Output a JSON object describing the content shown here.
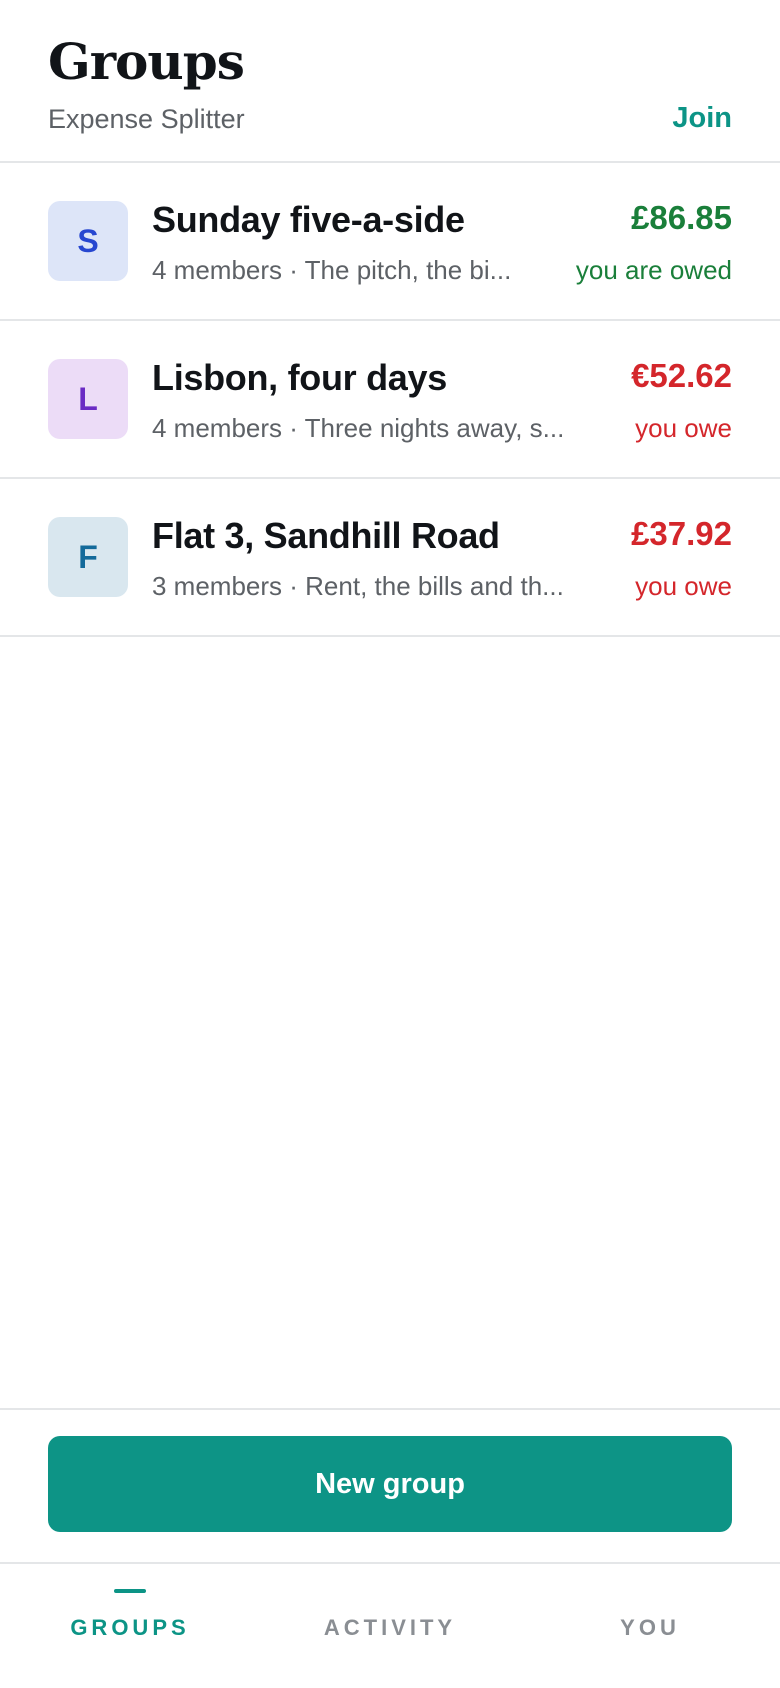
{
  "header": {
    "title": "Groups",
    "subtitle": "Expense Splitter",
    "join_label": "Join"
  },
  "groups": [
    {
      "initial": "S",
      "name": "Sunday five-a-side",
      "subtitle": "4 members · The pitch, the bi...",
      "amount": "£86.85",
      "status": "you are owed",
      "status_type": "owed",
      "avatar_bg": "#dde5f8",
      "avatar_fg": "#2747d0",
      "amount_color": "#1a7f3a"
    },
    {
      "initial": "L",
      "name": "Lisbon, four days",
      "subtitle": "4 members · Three nights away, s...",
      "amount": "€52.62",
      "status": "you owe",
      "status_type": "owe",
      "avatar_bg": "#ecdcf7",
      "avatar_fg": "#6a2bc4",
      "amount_color": "#d4262b"
    },
    {
      "initial": "F",
      "name": "Flat 3, Sandhill Road",
      "subtitle": "3 members · Rent, the bills and th...",
      "amount": "£37.92",
      "status": "you owe",
      "status_type": "owe",
      "avatar_bg": "#d9e7ef",
      "avatar_fg": "#136a9a",
      "amount_color": "#d4262b"
    }
  ],
  "actions": {
    "new_group_label": "New group"
  },
  "tabs": [
    {
      "label": "GROUPS",
      "active": true
    },
    {
      "label": "ACTIVITY",
      "active": false
    },
    {
      "label": "YOU",
      "active": false
    }
  ],
  "colors": {
    "accent": "#0c9486",
    "positive": "#1a7f3a",
    "negative": "#d4262b"
  }
}
